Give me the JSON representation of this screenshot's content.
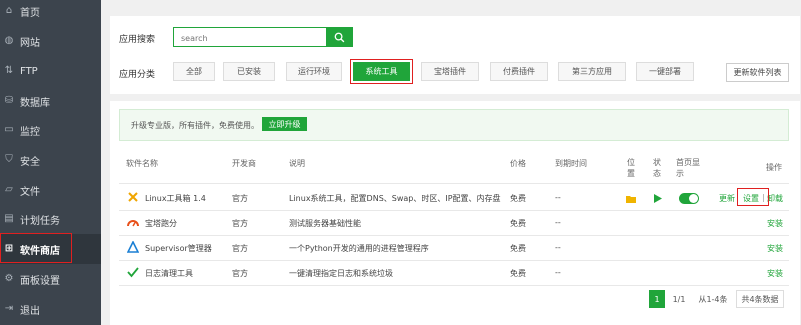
{
  "sidebar": {
    "items": [
      {
        "label": "首页",
        "icon": "home-icon",
        "glyph": "⌂"
      },
      {
        "label": "网站",
        "icon": "globe-icon",
        "glyph": "◍"
      },
      {
        "label": "FTP",
        "icon": "ftp-icon",
        "glyph": "⇅"
      },
      {
        "label": "数据库",
        "icon": "database-icon",
        "glyph": "⛁"
      },
      {
        "label": "监控",
        "icon": "monitor-icon",
        "glyph": "▭"
      },
      {
        "label": "安全",
        "icon": "shield-icon",
        "glyph": "⛉"
      },
      {
        "label": "文件",
        "icon": "folder-icon",
        "glyph": "▱"
      },
      {
        "label": "计划任务",
        "icon": "calendar-icon",
        "glyph": "▤"
      },
      {
        "label": "软件商店",
        "icon": "grid-icon",
        "glyph": "⊞"
      },
      {
        "label": "面板设置",
        "icon": "settings-icon",
        "glyph": "⚙"
      },
      {
        "label": "退出",
        "icon": "logout-icon",
        "glyph": "⇥"
      }
    ]
  },
  "search": {
    "label": "应用搜索",
    "placeholder": "search"
  },
  "categories": {
    "label": "应用分类",
    "items": [
      "全部",
      "已安装",
      "运行环境",
      "系统工具",
      "宝塔插件",
      "付费插件",
      "第三方应用",
      "一键部署"
    ],
    "active": "系统工具"
  },
  "update_button": "更新软件列表",
  "promo": {
    "text": "升级专业版，所有插件，免费使用。",
    "button": "立即升级"
  },
  "table": {
    "headers": {
      "name": "软件名称",
      "developer": "开发商",
      "desc": "说明",
      "price": "价格",
      "expire": "到期时间",
      "loc_1": "位",
      "loc_2": "置",
      "status_1": "状",
      "status_2": "态",
      "home_1": "首页显",
      "home_2": "示",
      "op": "操作"
    },
    "rows": [
      {
        "name": "Linux工具箱 1.4",
        "developer": "官方",
        "desc": "Linux系统工具，配置DNS、Swap、时区、IP配置、内存盘",
        "price": "免费",
        "expire": "--",
        "op_update": "更新",
        "op_set": "设置",
        "op_sep": "|",
        "op_uninstall": "卸载"
      },
      {
        "name": "宝塔跑分",
        "developer": "官方",
        "desc": "测试服务器基础性能",
        "price": "免费",
        "expire": "--",
        "op_install": "安装"
      },
      {
        "name": "Supervisor管理器",
        "developer": "官方",
        "desc": "一个Python开发的通用的进程管理程序",
        "price": "免费",
        "expire": "--",
        "op_install": "安装"
      },
      {
        "name": "日志清理工具",
        "developer": "官方",
        "desc": "一键清理指定日志和系统垃圾",
        "price": "免费",
        "expire": "--",
        "op_install": "安装"
      }
    ]
  },
  "pagination": {
    "current": "1",
    "pages": "1/1",
    "range": "从1-4条",
    "total": "共4条数据"
  },
  "colors": {
    "accent": "#20a53a",
    "sidebar": "#3c444d",
    "highlight": "#e02020"
  }
}
